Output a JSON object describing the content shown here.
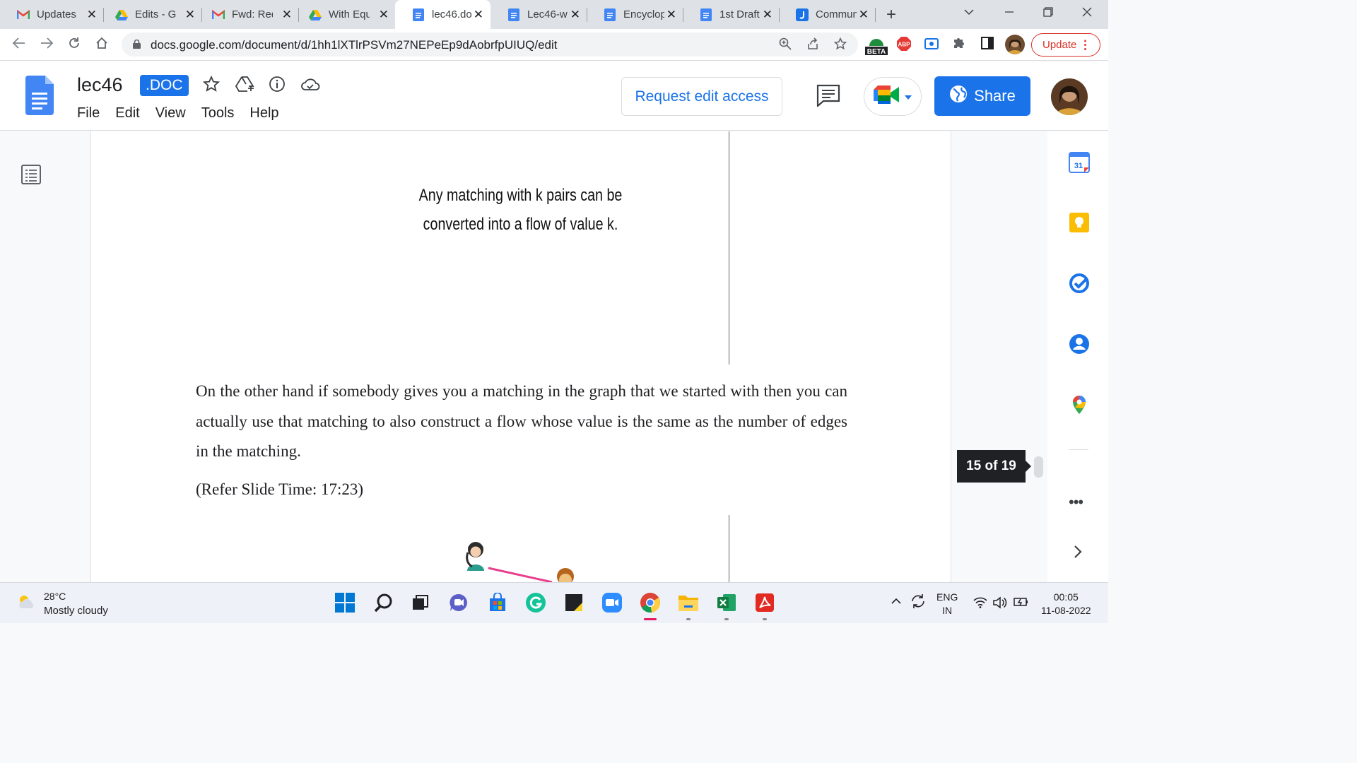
{
  "browser": {
    "tabs": [
      {
        "title": "Updates",
        "icon": "gmail-icon"
      },
      {
        "title": "Edits - G",
        "icon": "drive-icon"
      },
      {
        "title": "Fwd: Req",
        "icon": "gmail-icon"
      },
      {
        "title": "With Equ",
        "icon": "drive-icon"
      },
      {
        "title": "lec46.do",
        "icon": "docs-icon",
        "active": true
      },
      {
        "title": "Lec46-w",
        "icon": "docs-icon"
      },
      {
        "title": "Encyclop",
        "icon": "docs-icon"
      },
      {
        "title": "1st Draft",
        "icon": "docs-icon"
      },
      {
        "title": "Commun",
        "icon": "j-icon"
      }
    ],
    "url": "docs.google.com/document/d/1hh1lXTlrPSVm27NEPeEp9dAobrfpUIUQ/edit",
    "update_label": "Update",
    "beta_label": "BETA",
    "abp_label": "ABP"
  },
  "docs": {
    "title": "lec46",
    "badge": ".DOC",
    "menu": [
      "File",
      "Edit",
      "View",
      "Tools",
      "Help"
    ],
    "request_edit_label": "Request edit access",
    "share_label": "Share"
  },
  "document": {
    "slide_text_line1": "Any matching with k pairs can be",
    "slide_text_line2": "converted into a flow of value k.",
    "paragraph": "On the other hand if somebody gives you a matching in the graph that we started with then you can actually use that matching to also construct a flow whose value is the same as the number of edges in the matching.",
    "refer": "(Refer Slide Time: 17:23)",
    "page_indicator": "15 of 19"
  },
  "side_panel": {
    "calendar_day": "31",
    "icons": [
      "calendar-icon",
      "keep-icon",
      "tasks-icon",
      "contacts-icon",
      "maps-icon",
      "more-icon",
      "expand-icon"
    ]
  },
  "taskbar": {
    "temperature": "28°C",
    "condition": "Mostly cloudy",
    "lang_line1": "ENG",
    "lang_line2": "IN",
    "time": "00:05",
    "date": "11-08-2022"
  },
  "colors": {
    "accent": "#1a73e8",
    "update_red": "#d93025",
    "tabstrip": "#dee1e6"
  }
}
